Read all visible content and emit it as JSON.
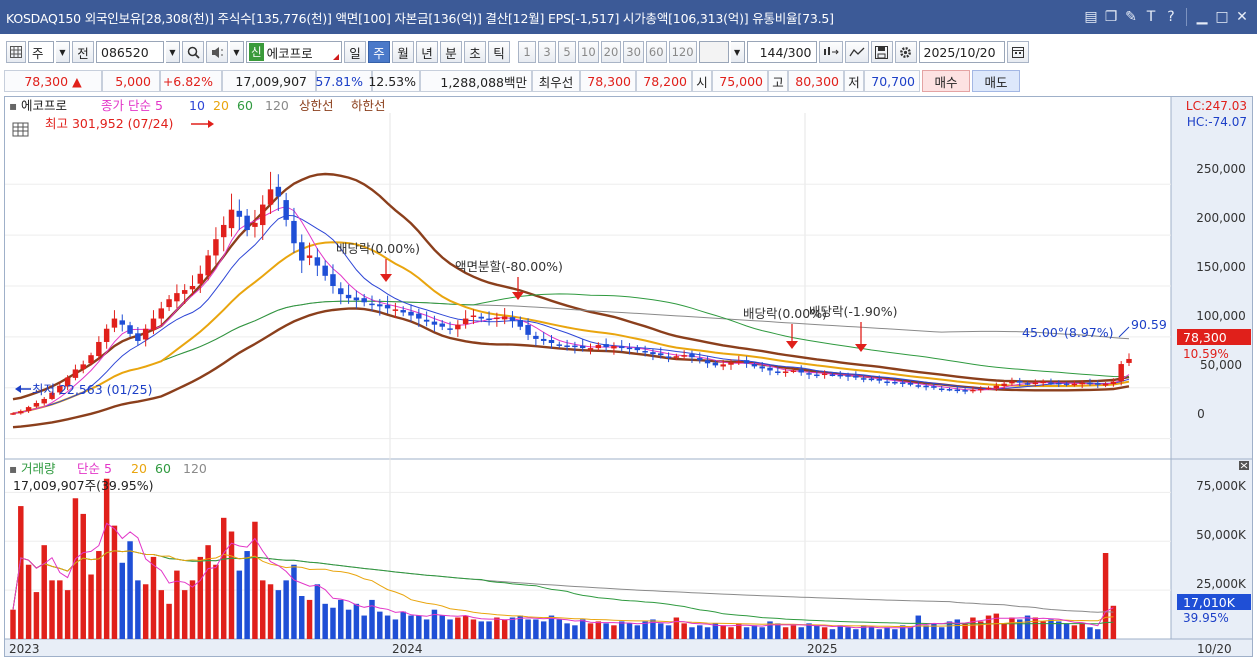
{
  "titlebar": {
    "title": "KOSDAQ150 외국인보유[28,308(천)] 주식수[135,776(천)] 액면[100] 자본금[136(억)] 결산[12월] EPS[-1,517] 시가총액[106,313(억)] 유통비율[73.5]",
    "icons": [
      "layout-icon",
      "copy-icon",
      "tools-icon",
      "text-icon",
      "help-icon",
      "minimize-icon",
      "maximize-icon",
      "close-icon"
    ]
  },
  "toolbar": {
    "type_label": "주",
    "jeon_label": "전",
    "code_value": "086520",
    "sin_badge": "신",
    "stock_name": "에코프로",
    "periods": [
      "일",
      "주",
      "월",
      "년",
      "분",
      "초",
      "틱"
    ],
    "active_period": "주",
    "minute_values": [
      "1",
      "3",
      "5",
      "10",
      "20",
      "30",
      "60",
      "120"
    ],
    "count_value": "144",
    "count_total": "/300",
    "date_value": "2025/10/20"
  },
  "quote": {
    "price": "78,300",
    "change": "5,000",
    "change_pct": "+6.82%",
    "volume": "17,009,907",
    "vol_ratio": "57.81%",
    "turnover": "12.53%",
    "amount": "1,288,088백만",
    "best_label": "최우선",
    "best_ask": "78,300",
    "best_bid": "78,200",
    "open_label": "시",
    "open": "75,000",
    "high_label": "고",
    "high": "80,300",
    "low_label": "저",
    "low": "70,700",
    "buy_label": "매수",
    "sell_label": "매도"
  },
  "chart_data": [
    {
      "type": "candlestick",
      "legend": [
        "에코프로",
        "종가 단순 5",
        "10",
        "20",
        "60",
        "120",
        "상한선",
        "하한선"
      ],
      "colors": {
        "up": "#e0201b",
        "down": "#1f4fd6",
        "ma5": "#e236c8",
        "ma10": "#2e46d6",
        "ma20": "#e9a50e",
        "ma60": "#2f9a3f",
        "ma120": "#8a8a8a",
        "band": "#8b3f1c"
      },
      "y_ticks": [
        "250,000",
        "200,000",
        "150,000",
        "100,000",
        "50,000",
        "0"
      ],
      "ylim": [
        -20000,
        320000
      ],
      "lc": "LC:247.03",
      "hc": "HC:-74.07",
      "high_label": "최고 301,952 (07/24)",
      "low_label": "최저 22,563 (01/25)",
      "annotations": [
        "배당락(0.00%)",
        "액면분할(-80.00%)",
        "배당락(0.00%)",
        "배당락(-1.90%)"
      ],
      "trend_label": "45.00°(8.97%)",
      "trend_value": "90.59",
      "price_tag": "78,300",
      "price_tag_pct": "10.59%",
      "x_labels": [
        "2023",
        "2024",
        "2025",
        "10/20"
      ],
      "close": [
        25000,
        27000,
        31000,
        35000,
        39000,
        45000,
        52000,
        60000,
        68000,
        73000,
        82000,
        95000,
        108000,
        118000,
        112000,
        103000,
        96000,
        108000,
        118000,
        128000,
        137000,
        143000,
        146000,
        150000,
        162000,
        180000,
        196000,
        210000,
        225000,
        218000,
        205000,
        212000,
        230000,
        245000,
        238000,
        215000,
        192000,
        175000,
        180000,
        170000,
        160000,
        150000,
        142000,
        138000,
        136000,
        134000,
        132000,
        130000,
        128000,
        127000,
        124000,
        121000,
        118000,
        115000,
        112000,
        110000,
        108000,
        112000,
        118000,
        121000,
        118000,
        117000,
        119000,
        120000,
        116000,
        110000,
        102000,
        98000,
        96000,
        94000,
        92000,
        91000,
        90000,
        89000,
        89000,
        92000,
        90000,
        91000,
        89000,
        88000,
        87000,
        85000,
        83000,
        82000,
        80000,
        81000,
        82000,
        80000,
        77000,
        74000,
        72000,
        73000,
        75000,
        76000,
        74000,
        71000,
        69000,
        67000,
        65000,
        66000,
        67000,
        65000,
        63000,
        62000,
        64000,
        63000,
        62000,
        61000,
        60000,
        59000,
        58000,
        57000,
        56000,
        55000,
        54000,
        53000,
        52000,
        51000,
        50000,
        49000,
        48000,
        47000,
        47000,
        48000,
        49000,
        50000,
        52000,
        54000,
        56000,
        55000,
        54000,
        55000,
        56000,
        55000,
        54000,
        53000,
        54000,
        55000,
        54000,
        53000,
        54000,
        56000,
        73300,
        78300
      ]
    },
    {
      "type": "bar",
      "legend": [
        "거래량",
        "단순 5",
        "20",
        "60",
        "120"
      ],
      "colors": {
        "ma5": "#e236c8",
        "ma20": "#e9a50e",
        "ma60": "#2f9a3f",
        "ma120": "#8a8a8a"
      },
      "current_label": "17,009,907주(39.95%)",
      "y_ticks": [
        "75,000K",
        "50,000K",
        "25,000K"
      ],
      "ylim": [
        0,
        88000
      ],
      "volume_tag": "17,010K",
      "volume_pct": "39.95%",
      "values": [
        15000,
        68000,
        38000,
        24000,
        48000,
        30000,
        30000,
        25000,
        72000,
        64000,
        33000,
        45000,
        82000,
        58000,
        39000,
        50000,
        30000,
        28000,
        42000,
        25000,
        18000,
        35000,
        25000,
        30000,
        42000,
        48000,
        38000,
        62000,
        55000,
        35000,
        45000,
        60000,
        30000,
        28000,
        25000,
        30000,
        38000,
        22000,
        20000,
        28000,
        18000,
        16000,
        20000,
        15000,
        18000,
        12000,
        20000,
        14000,
        12000,
        10000,
        14000,
        12000,
        12000,
        10000,
        15000,
        12000,
        10000,
        11000,
        12000,
        10000,
        9000,
        9000,
        11000,
        10000,
        11000,
        12000,
        10000,
        10000,
        9000,
        12000,
        10000,
        8000,
        7000,
        10000,
        8000,
        9000,
        8000,
        7000,
        9000,
        8000,
        7000,
        9000,
        10000,
        8000,
        7000,
        11000,
        8000,
        6000,
        7000,
        6000,
        8000,
        7000,
        6000,
        8000,
        6000,
        7000,
        6000,
        9000,
        8000,
        6000,
        7000,
        6000,
        8000,
        7000,
        6000,
        5000,
        7000,
        6000,
        5000,
        7000,
        6000,
        5000,
        6000,
        5000,
        7000,
        6000,
        12000,
        7000,
        8000,
        6000,
        9000,
        10000,
        8000,
        11000,
        9000,
        12000,
        13000,
        8000,
        11000,
        10000,
        12000,
        11000,
        9000,
        10000,
        9000,
        8000,
        7000,
        8000,
        6000,
        5000,
        44000,
        17000
      ]
    }
  ]
}
